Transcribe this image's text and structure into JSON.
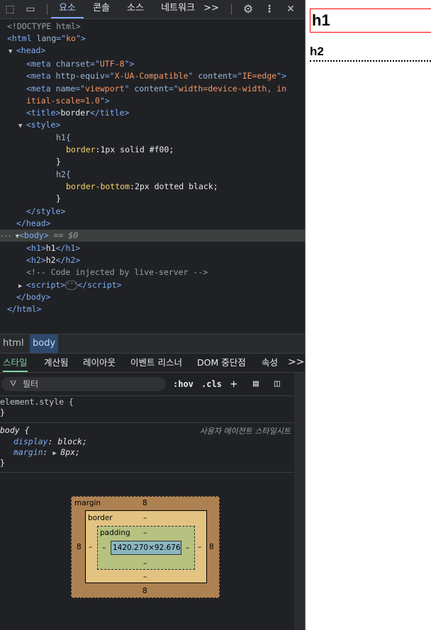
{
  "toolbar": {
    "inspect_icon": "element-picker-icon",
    "device_icon": "device-toggle-icon",
    "tabs": [
      "요소",
      "콘솔",
      "소스",
      "네트워크"
    ],
    "more": ">>",
    "settings_icon": "gear-icon",
    "menu_icon": "kebab-menu-icon",
    "close": "✕"
  },
  "code": {
    "doctype": "<!DOCTYPE html>",
    "html_lang": "ko",
    "meta1_charset": "UTF-8",
    "meta2_http_equiv": "X-UA-Compatible",
    "meta2_content": "IE=edge",
    "meta3_name": "viewport",
    "meta3_content_a": "width=device-width, in",
    "meta3_content_b": "itial-scale=1.0",
    "title": "border",
    "css_h1_selector": "h1{",
    "css_h1_prop": "border",
    "css_h1_value": ":1px solid #f00;",
    "css_h2_selector": "h2{",
    "css_h2_prop": "border-bottom",
    "css_h2_value": ":2px dotted black;",
    "css_close": "}",
    "body_marker": "== $0",
    "h1_text": "h1",
    "h2_text": "h2",
    "comment": "<!-- Code injected by live-server -->"
  },
  "breadcrumbs": [
    "html",
    "body"
  ],
  "style_tabs": [
    "스타일",
    "계산됨",
    "레이아웃",
    "이벤트 리스너",
    "DOM 중단점",
    "속성"
  ],
  "style_tabs_more": ">>",
  "filter": {
    "icon": "filter-icon",
    "placeholder": "필터",
    "hov": ":hov",
    "cls": ".cls",
    "add": "+",
    "brush_icon": "paint-brush-icon",
    "panel_icon": "toggle-sidebar-icon"
  },
  "rules": {
    "element_style_selector": "element.style {",
    "element_style_close": "}",
    "body_selector": "body {",
    "body_source": "사용자 에이전트 스타일시트",
    "body_prop1": "display",
    "body_val1": "block;",
    "body_prop2": "margin",
    "body_val2": "8px;",
    "body_close": "}"
  },
  "box_model": {
    "margin_label": "margin",
    "margin_top": "8",
    "margin_bottom": "8",
    "margin_left": "8",
    "margin_right": "8",
    "border_label": "border",
    "border_top": "–",
    "border_bottom": "–",
    "border_left": "–",
    "border_right": "–",
    "padding_label": "padding",
    "padding_top": "–",
    "padding_bottom": "–",
    "padding_left": "–",
    "padding_right": "–",
    "content": "1420.270×92.676"
  },
  "preview": {
    "h1": "h1",
    "h2": "h2"
  }
}
